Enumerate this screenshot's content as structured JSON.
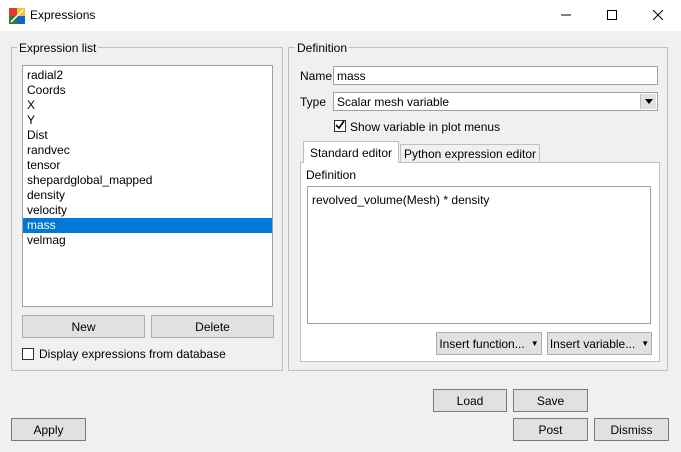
{
  "window": {
    "title": "Expressions",
    "minimize_icon": "minimize-icon",
    "maximize_icon": "maximize-icon",
    "close_icon": "close-icon"
  },
  "expression_list": {
    "legend": "Expression list",
    "items": [
      "radial2",
      "Coords",
      "X",
      "Y",
      "Dist",
      "randvec",
      "tensor",
      "shepardglobal_mapped",
      "density",
      "velocity",
      "mass",
      "velmag"
    ],
    "selected_index": 10,
    "new_label": "New",
    "delete_label": "Delete",
    "display_from_db_label": "Display expressions from database",
    "display_from_db_checked": false
  },
  "definition": {
    "legend": "Definition",
    "name_label": "Name",
    "name_value": "mass",
    "type_label": "Type",
    "type_value": "Scalar mesh variable",
    "show_in_menus_label": "Show variable in plot menus",
    "show_in_menus_checked": true,
    "tabs": [
      {
        "label": "Standard editor",
        "active": true
      },
      {
        "label": "Python expression editor",
        "active": false
      }
    ],
    "editor_label": "Definition",
    "editor_text": "revolved_volume(Mesh) * density",
    "insert_function_label": "Insert function...",
    "insert_variable_label": "Insert variable..."
  },
  "footer": {
    "load_label": "Load",
    "save_label": "Save",
    "apply_label": "Apply",
    "post_label": "Post",
    "dismiss_label": "Dismiss"
  },
  "colors": {
    "selection": "#0078d7",
    "background": "#f0f0f0"
  }
}
